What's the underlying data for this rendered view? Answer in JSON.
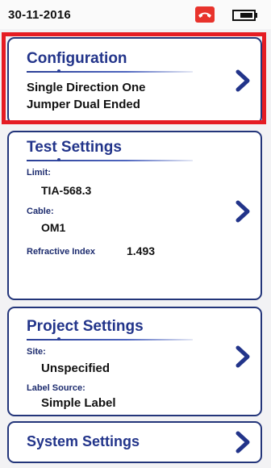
{
  "status_bar": {
    "date": "30-11-2016",
    "phone_icon": "phone-hangup-icon",
    "battery_icon": "battery-icon"
  },
  "configuration": {
    "title": "Configuration",
    "line1": "Single Direction One",
    "line2": "Jumper Dual Ended",
    "chevron_icon": "chevron-right-icon",
    "highlight_color": "#e51c23"
  },
  "test_settings": {
    "title": "Test Settings",
    "limit_label": "Limit:",
    "limit_value": "TIA-568.3",
    "cable_label": "Cable:",
    "cable_value": "OM1",
    "refractive_label": "Refractive Index",
    "refractive_value": "1.493",
    "chevron_icon": "chevron-right-icon"
  },
  "project_settings": {
    "title": "Project Settings",
    "site_label": "Site:",
    "site_value": "Unspecified",
    "label_source_label": "Label Source:",
    "label_source_value": "Simple Label",
    "chevron_icon": "chevron-right-icon"
  },
  "system_settings": {
    "title": "System Settings",
    "chevron_icon": "chevron-right-icon"
  },
  "colors": {
    "accent": "#22348a",
    "highlight": "#e51c23",
    "phone_badge": "#e8332c"
  }
}
